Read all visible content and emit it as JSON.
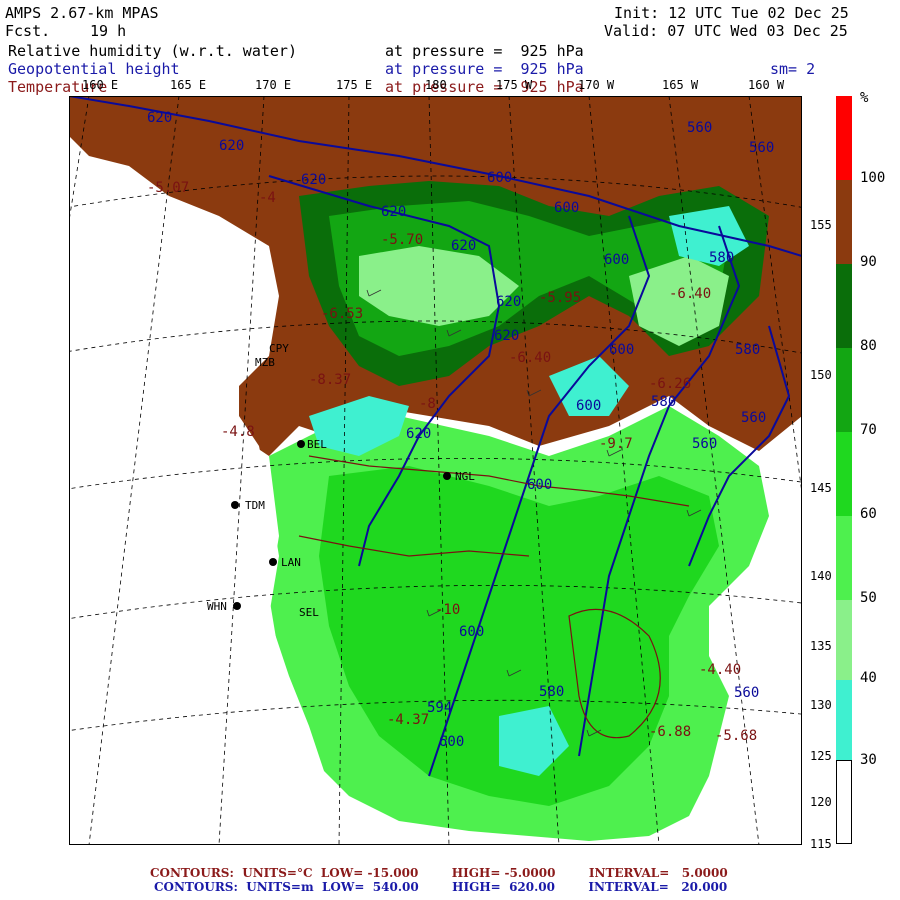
{
  "header": {
    "model": "AMPS 2.67-km MPAS",
    "fcst_label": "Fcst.",
    "fcst_value": "19 h",
    "init": "Init: 12 UTC Tue 02 Dec 25",
    "valid": "Valid: 07 UTC Wed 03 Dec 25",
    "fields": [
      {
        "name": "Relative humidity (w.r.t. water)",
        "level": "at pressure =  925 hPa"
      },
      {
        "name": "Geopotential height",
        "level": "at pressure =  925 hPa",
        "extra": "sm= 2"
      },
      {
        "name": "Temperature",
        "level": "at pressure =  925 hPa"
      }
    ]
  },
  "colors": {
    "rh_100": "#ff0000",
    "rh_90": "#8b3a0f",
    "rh_80": "#0a6e0a",
    "rh_70": "#13a613",
    "rh_60": "#1fd81f",
    "rh_50": "#4ef04e",
    "rh_40": "#8af08a",
    "rh_30": "#3ff0d0",
    "height_contour": "#0a0a9a",
    "temp_contour": "#7a1212",
    "white": "#ffffff"
  },
  "colorbar": {
    "unit": "%",
    "labels": [
      "100",
      "90",
      "80",
      "70",
      "60",
      "50",
      "40",
      "30"
    ]
  },
  "lon_labels": [
    "160 E",
    "165 E",
    "170 E",
    "175 E",
    "180",
    "175 W",
    "170 W",
    "165 W",
    "160 W"
  ],
  "lat_labels": [
    "155",
    "150",
    "145",
    "140",
    "135",
    "130",
    "125",
    "120",
    "115"
  ],
  "height_labels": [
    "620",
    "620",
    "620",
    "620",
    "620",
    "620",
    "620",
    "620",
    "600",
    "600",
    "600",
    "600",
    "600",
    "600",
    "600",
    "600",
    "580",
    "580",
    "580",
    "580",
    "560",
    "560",
    "560",
    "560",
    "594",
    "560"
  ],
  "temp_labels": [
    "-5.07",
    "-4",
    "-5.70",
    "-6.53",
    "-5.95",
    "-6.40",
    "-6.40",
    "-6.26",
    "-8",
    "-10",
    "-9.7",
    "-8.37",
    "-4.37",
    "-4.40",
    "-5.68",
    "-6.88",
    "-4.8"
  ],
  "station_labels": [
    "CPY",
    "MZB",
    "BEL",
    "TDM",
    "NGL",
    "LAN",
    "WHN",
    "SEL"
  ],
  "footer": {
    "line1": "CONTOURS:  UNITS=°C  LOW= -15.000        HIGH= -5.0000        INTERVAL=   5.0000",
    "line2": "CONTOURS:  UNITS=m  LOW=  540.00        HIGH=  620.00        INTERVAL=   20.000"
  }
}
